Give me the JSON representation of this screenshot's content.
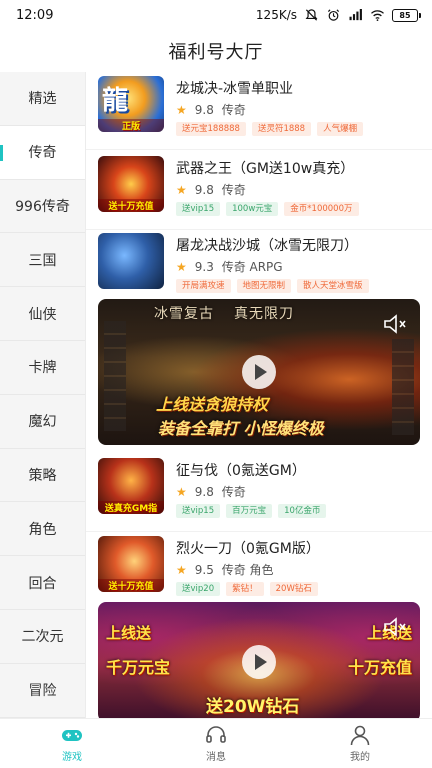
{
  "status_bar": {
    "time": "12:09",
    "speed": "125K/s",
    "battery": "85"
  },
  "header": {
    "title": "福利号大厅"
  },
  "sidebar": {
    "items": [
      {
        "label": "精选"
      },
      {
        "label": "传奇"
      },
      {
        "label": "996传奇"
      },
      {
        "label": "三国"
      },
      {
        "label": "仙侠"
      },
      {
        "label": "卡牌"
      },
      {
        "label": "魔幻"
      },
      {
        "label": "策略"
      },
      {
        "label": "角色"
      },
      {
        "label": "回合"
      },
      {
        "label": "二次元"
      },
      {
        "label": "冒险"
      }
    ],
    "active_index": 1
  },
  "games": [
    {
      "name": "龙城决-冰雪单职业",
      "rating": "9.8",
      "genre": "传奇",
      "tags": [
        "送元宝188888",
        "送灵符1888",
        "人气爆棚"
      ],
      "thumb_text": "正版",
      "thumb_big": "龍"
    },
    {
      "name": "武器之王（GM送10w真充）",
      "rating": "9.8",
      "genre": "传奇",
      "tags": [
        "送vip15",
        "100w元宝",
        "金币*100000万"
      ],
      "thumb_text": "送十万充值"
    },
    {
      "name": "屠龙决战沙城（冰雪无限刀）",
      "rating": "9.3",
      "genre": "传奇 ARPG",
      "tags": [
        "开局满攻速",
        "地图无限制",
        "散人天堂冰雪版"
      ]
    },
    {
      "name": "征与伐（0氪送GM）",
      "rating": "9.8",
      "genre": "传奇",
      "tags": [
        "送vip15",
        "百万元宝",
        "10亿金币"
      ],
      "thumb_text": "送真充GM指"
    },
    {
      "name": "烈火一刀（0氪GM版）",
      "rating": "9.5",
      "genre": "传奇 角色",
      "tags": [
        "送vip20",
        "紫钻！",
        "20W钻石"
      ],
      "thumb_text": "送十万充值"
    }
  ],
  "video_a": {
    "top_left": "冰雪复古",
    "top_right": "真无限刀",
    "line1": "上线送贪狼持权",
    "line2": "装备全靠打 小怪爆终极"
  },
  "video_b": {
    "left": "上线送",
    "center": "送20W钻石",
    "right": "上线送",
    "left_amount": "千万元宝",
    "right_amount": "十万充值"
  },
  "bottom_nav": [
    {
      "label": "游戏",
      "icon": "gamepad-icon"
    },
    {
      "label": "消息",
      "icon": "headset-icon"
    },
    {
      "label": "我的",
      "icon": "user-icon"
    }
  ],
  "colors": {
    "accent": "#1fc3c2",
    "tag_orange": "#ef6a3a",
    "tag_green": "#3aa56b",
    "star": "#f5a623"
  }
}
